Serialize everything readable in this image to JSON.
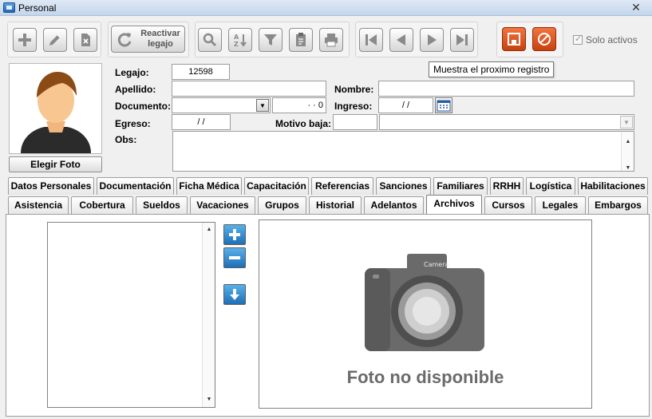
{
  "window": {
    "title": "Personal",
    "close_glyph": "✕"
  },
  "toolbar": {
    "reactivar_line1": "Reactivar",
    "reactivar_line2": "legajo",
    "solo_activos_label": "Solo activos",
    "solo_activos_checked": true,
    "icons": [
      "add-icon",
      "edit-icon",
      "delete-icon",
      "reactivate-icon",
      "search-icon",
      "sort-az-icon",
      "filter-icon",
      "clipboard-icon",
      "print-icon",
      "first-record-icon",
      "previous-record-icon",
      "next-record-icon",
      "last-record-icon",
      "save-icon",
      "cancel-icon"
    ]
  },
  "tooltip": "Muestra el proximo registro",
  "photo": {
    "button_label": "Elegir Foto"
  },
  "form": {
    "legajo_label": "Legajo:",
    "legajo_value": "12598",
    "apellido_label": "Apellido:",
    "apellido_value": "",
    "nombre_label": "Nombre:",
    "nombre_value": "",
    "documento_label": "Documento:",
    "documento_number": "·  ·  0",
    "ingreso_label": "Ingreso:",
    "ingreso_value": "/  /",
    "egreso_label": "Egreso:",
    "egreso_value": "/  /",
    "motivo_label": "Motivo baja:",
    "obs_label": "Obs:"
  },
  "tabs_row1": [
    "Datos Personales",
    "Documentación",
    "Ficha Médica",
    "Capacitación",
    "Referencias",
    "Sanciones",
    "Familiares",
    "RRHH",
    "Logística",
    "Habilitaciones"
  ],
  "tabs_row2": [
    "Asistencia",
    "Cobertura",
    "Sueldos",
    "Vacaciones",
    "Grupos",
    "Historial",
    "Adelantos",
    "Archivos",
    "Cursos",
    "Legales",
    "Embargos"
  ],
  "selected_tab": "Archivos",
  "archivos": {
    "no_photo_text": "Foto no disponible",
    "camera_brand": "Camera"
  },
  "colors": {
    "accent_blue": "#2a7fcf",
    "save_red": "#d9531e"
  }
}
